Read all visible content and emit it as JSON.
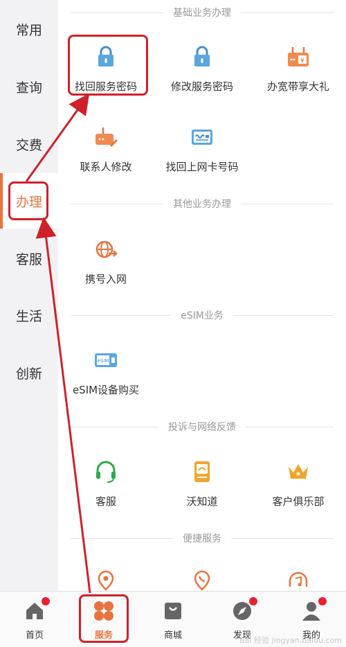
{
  "sidebar": {
    "items": [
      {
        "label": "常用"
      },
      {
        "label": "查询"
      },
      {
        "label": "交费"
      },
      {
        "label": "办理"
      },
      {
        "label": "客服"
      },
      {
        "label": "生活"
      },
      {
        "label": "创新"
      }
    ],
    "active": "办理"
  },
  "sections": {
    "basic": {
      "title": "基础业务办理",
      "items": [
        {
          "label": "找回服务密码",
          "icon": "lock-icon"
        },
        {
          "label": "修改服务密码",
          "icon": "lock-icon"
        },
        {
          "label": "办宽带享大礼",
          "icon": "router-gift-icon"
        },
        {
          "label": "联系人修改",
          "icon": "router-edit-icon"
        },
        {
          "label": "找回上网卡号码",
          "icon": "card-icon"
        }
      ]
    },
    "other": {
      "title": "其他业务办理",
      "items": [
        {
          "label": "携号入网",
          "icon": "globe-transfer-icon"
        }
      ]
    },
    "esim": {
      "title": "eSIM业务",
      "items": [
        {
          "label": "eSIM设备购买",
          "icon": "esim-card-icon"
        }
      ]
    },
    "feedback": {
      "title": "投诉与网络反馈",
      "items": [
        {
          "label": "客服",
          "icon": "headset-icon"
        },
        {
          "label": "沃知道",
          "icon": "document-icon"
        },
        {
          "label": "客户俱乐部",
          "icon": "crown-icon"
        }
      ]
    },
    "quick": {
      "title": "便捷服务"
    }
  },
  "tabbar": {
    "tabs": [
      {
        "label": "首页",
        "icon": "home-icon",
        "badge": true
      },
      {
        "label": "服务",
        "icon": "service-grid-icon",
        "badge": false
      },
      {
        "label": "商城",
        "icon": "shopping-bag-icon",
        "badge": false
      },
      {
        "label": "发现",
        "icon": "compass-icon",
        "badge": true
      },
      {
        "label": "我的",
        "icon": "user-icon",
        "badge": true
      }
    ],
    "active": "服务"
  },
  "colors": {
    "accent": "#e9733d",
    "icon_blue": "#3b8fd4",
    "icon_orange": "#e9733d",
    "icon_green": "#2fa84f",
    "icon_gold": "#f0a52a",
    "annotation_red": "#d0202a",
    "badge_red": "#e8212e"
  },
  "watermark": "Bai 经验 jingyan.baidu.com"
}
